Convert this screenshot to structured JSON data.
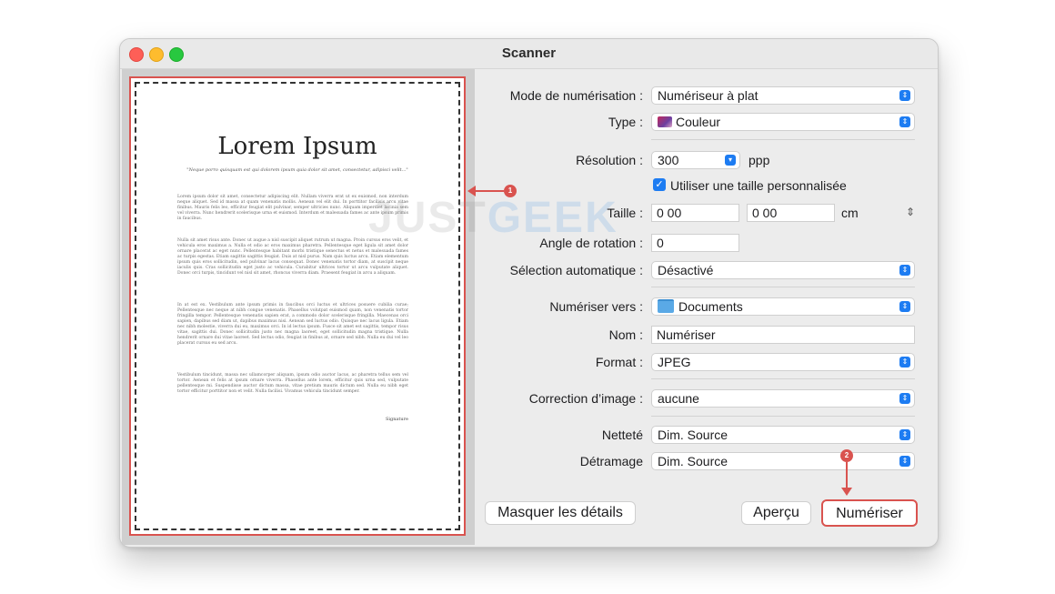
{
  "window": {
    "title": "Scanner"
  },
  "document": {
    "title": "Lorem Ipsum",
    "subtitle": "\"Neque porro quisquam est qui dolorem ipsum quia dolor sit amet, consectetur, adipisci velit...\"",
    "paragraph1": "Lorem ipsum dolor sit amet, consectetur adipiscing elit. Nullam viverra erat ut ex euismod, non interdum neque aliquet. Sed id massa at quam venenatis mollis. Aenean vel elit dui. In porttitor facilisis arcu vitae finibus. Mauris felis leo, efficitur feugiat elit pulvinar, semper ultricies nunc. Aliquam imperdiet lacinia sem vel viverra. Nunc hendrerit scelerisque urna et euismod. Interdum et malesuada fames ac ante ipsum primis in faucibus.",
    "paragraph2": "Nulla sit amet risus ante. Donec ut augue a nisl suscipit aliquet rutrum ut magna. Proin cursus eros velit, et vehicula eros maximus a. Nulla et odio ac eros maximus pharetra. Pellentesque eget ligula sit amet dolor ornare placerat ac eget nunc. Pellentesque habitant morbi tristique senectus et netus et malesuada fames ac turpis egestas. Etiam sagittis sagittis feugiat. Duis at nisl purus. Nam quis luctus arcu. Etiam elementum ipsum quis eros sollicitudin, sed pulvinar lacus consequat. Donec venenatis tortor diam, at suscipit neque iaculis quis. Cras sollicitudin eget justo ac vehicula. Curabitur ultrices tortor ut arcu vulputate aliquet. Donec orci turpis, tincidunt vel nisl sit amet, rhoncus viverra diam. Praesent feugiat in arcu a aliquam.",
    "paragraph3": "In at est ex. Vestibulum ante ipsum primis in faucibus orci luctus et ultrices posuere cubilia curae; Pellentesque nec neque at nibh congue venenatis. Phasellus volutpat euismod quam, non venenatis tortor fringilla tempor. Pellentesque venenatis sapien erat, a commodo dolor scelerisque fringilla. Maecenas orci sapien, dapibus sed diam ut, dapibus maximus nisi. Aenean sed luctus odio. Quisque nec lacus ligula. Etiam nec nibh molestie, viverra dui eu, maximus orci. In id lectus ipsum. Fusce sit amet est sagittis, tempor risus vitae, sagittis dui. Donec sollicitudin justo nec magna laoreet, eget sollicitudin magna tristique. Nulla hendrerit ornare dui vitae laoreet. Sed lectus odio, feugiat in finibus at, ornare sed nibh. Nulla eu dui vel leo placerat cursus eu sed arcu.",
    "paragraph4": "Vestibulum tincidunt, massa nec ullamcorper aliquam, ipsum odio auctor lacus, ac pharetra tellus sem vel tortor. Aenean et felis at ipsum ornare viverra. Phasellus ante lorem, efficitur quis urna sed, vulputate pellentesque mi. Suspendisse auctor dictum massa, vitae pretium mauris dictum sed. Nulla eu nibh eget tortor efficitur porttitor non et velit. Nulla facilisi. Vivamus vehicula tincidunt semper.",
    "signature": "Signature"
  },
  "settings": {
    "mode_label": "Mode de numérisation :",
    "mode_value": "Numériseur à plat",
    "type_label": "Type :",
    "type_value": "Couleur",
    "resolution_label": "Résolution :",
    "resolution_value": "300",
    "resolution_unit": "ppp",
    "custom_size_label": "Utiliser une taille personnalisée",
    "size_label": "Taille :",
    "size_width": "0 00",
    "size_height": "0 00",
    "size_unit": "cm",
    "rotation_label": "Angle de rotation :",
    "rotation_value": "0",
    "autoselect_label": "Sélection automatique :",
    "autoselect_value": "Désactivé",
    "destination_label": "Numériser vers :",
    "destination_value": "Documents",
    "name_label": "Nom :",
    "name_value": "Numériser",
    "format_label": "Format :",
    "format_value": "JPEG",
    "correction_label": "Correction d’image :",
    "correction_value": "aucune",
    "sharpness_label": "Netteté",
    "sharpness_value": "Dim. Source",
    "descreen_label": "Détramage",
    "descreen_value": "Dim. Source"
  },
  "buttons": {
    "hide_details": "Masquer les détails",
    "preview": "Aperçu",
    "scan": "Numériser"
  },
  "annotations": {
    "badge1": "1",
    "badge2": "2"
  },
  "watermark": {
    "part1": "JUST",
    "part2": "GEEK"
  }
}
